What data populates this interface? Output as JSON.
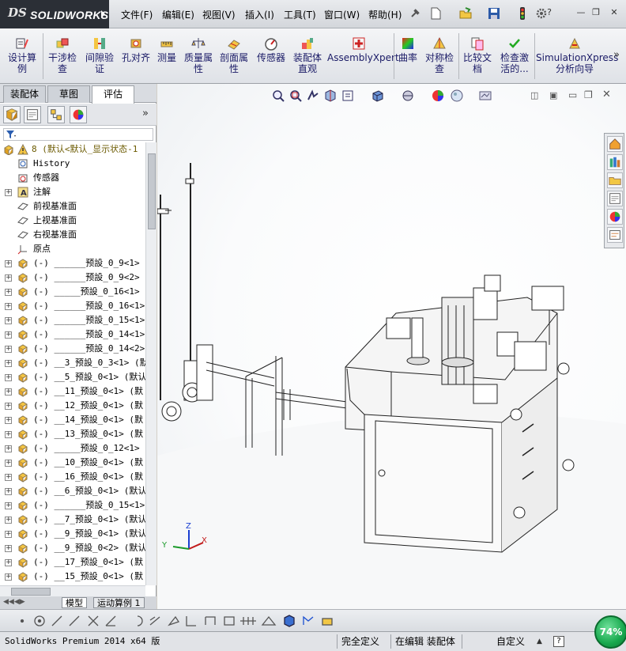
{
  "app": {
    "logo_ds": "DS",
    "logo_text": "SOLIDWORKS"
  },
  "menu": [
    "文件(F)",
    "编辑(E)",
    "视图(V)",
    "插入(I)",
    "工具(T)",
    "窗口(W)",
    "帮助(H)"
  ],
  "window_controls": {
    "help": "?",
    "minimize": "—",
    "restore": "❐",
    "close": "✕"
  },
  "commands": [
    {
      "label": "设计算\n例",
      "icon": "design-study-icon"
    },
    {
      "label": "干涉检\n查",
      "icon": "interference-check-icon"
    },
    {
      "label": "间隙验\n证",
      "icon": "clearance-verification-icon"
    },
    {
      "label": "孔对齐",
      "icon": "hole-alignment-icon"
    },
    {
      "label": "测量",
      "icon": "measure-icon"
    },
    {
      "label": "质量属\n性",
      "icon": "mass-properties-icon"
    },
    {
      "label": "剖面属\n性",
      "icon": "section-properties-icon"
    },
    {
      "label": "传感器",
      "icon": "sensor-icon"
    },
    {
      "label": "装配体\n直观",
      "icon": "assembly-visualization-icon"
    },
    {
      "label": "AssemblyXpert",
      "icon": "assemblyxpert-icon"
    },
    {
      "label": "曲率",
      "icon": "curvature-icon"
    },
    {
      "label": "对称检\n查",
      "icon": "symmetry-check-icon"
    },
    {
      "label": "比较文\n档",
      "icon": "compare-documents-icon"
    },
    {
      "label": "检查激\n活的...",
      "icon": "check-active-icon"
    },
    {
      "label": "SimulationXpress\n分析向导",
      "icon": "simulationxpress-icon"
    }
  ],
  "more_commands": "»",
  "panel_tabs": [
    "装配体",
    "草图",
    "评估"
  ],
  "panel_active_tab": "评估",
  "panel_expand": "»",
  "tree": {
    "root": "8  (默认<默认_显示状态-1",
    "items": [
      {
        "label": "History",
        "icon": "history-icon",
        "expand": false
      },
      {
        "label": "传感器",
        "icon": "sensor-folder-icon",
        "expand": false
      },
      {
        "label": "注解",
        "icon": "annotations-icon",
        "expand": true
      },
      {
        "label": "前视基准面",
        "icon": "plane-icon",
        "expand": false
      },
      {
        "label": "上视基准面",
        "icon": "plane-icon",
        "expand": false
      },
      {
        "label": "右视基准面",
        "icon": "plane-icon",
        "expand": false
      },
      {
        "label": "原点",
        "icon": "origin-icon",
        "expand": false
      },
      {
        "label": "(-) ______预設_0_9<1>",
        "icon": "part-icon",
        "expand": true
      },
      {
        "label": "(-) ______预設_0_9<2>",
        "icon": "part-icon",
        "expand": true
      },
      {
        "label": "(-) _____预設_0_16<1> (",
        "icon": "part-icon",
        "expand": true
      },
      {
        "label": "(-) ______预設_0_16<1>",
        "icon": "part-icon",
        "expand": true
      },
      {
        "label": "(-) ______预設_0_15<1>",
        "icon": "part-icon",
        "expand": true
      },
      {
        "label": "(-) ______预設_0_14<1>",
        "icon": "part-icon",
        "expand": true
      },
      {
        "label": "(-) ______预設_0_14<2>",
        "icon": "part-icon",
        "expand": true
      },
      {
        "label": "(-) __3_预設_0_3<1> (默",
        "icon": "part-icon",
        "expand": true
      },
      {
        "label": "(-) __5_预設_0<1> (默认",
        "icon": "part-icon",
        "expand": true
      },
      {
        "label": "(-) __11_预設_0<1> (默",
        "icon": "part-icon",
        "expand": true
      },
      {
        "label": "(-) __12_预設_0<1> (默",
        "icon": "part-icon",
        "expand": true
      },
      {
        "label": "(-) __14_预設_0<1> (默",
        "icon": "part-icon",
        "expand": true
      },
      {
        "label": "(-) __13_预設_0<1> (默",
        "icon": "part-icon",
        "expand": true
      },
      {
        "label": "(-) _____预設_0_12<1> (",
        "icon": "part-icon",
        "expand": true
      },
      {
        "label": "(-) __10_预設_0<1> (默",
        "icon": "part-icon",
        "expand": true
      },
      {
        "label": "(-) __16_预設_0<1> (默",
        "icon": "part-icon",
        "expand": true
      },
      {
        "label": "(-) __6_预設_0<1> (默认",
        "icon": "part-icon",
        "expand": true
      },
      {
        "label": "(-) ______预設_0_15<1> (",
        "icon": "part-icon",
        "expand": true
      },
      {
        "label": "(-) __7_预設_0<1> (默认",
        "icon": "part-icon",
        "expand": true
      },
      {
        "label": "(-) __9_预設_0<1> (默认",
        "icon": "part-icon",
        "expand": true
      },
      {
        "label": "(-) __9_预設_0<2> (默认",
        "icon": "part-icon",
        "expand": true
      },
      {
        "label": "(-) __17_预設_0<1> (默",
        "icon": "part-icon",
        "expand": true
      },
      {
        "label": "(-) __15_预設_0<1> (默",
        "icon": "part-icon",
        "expand": true
      }
    ]
  },
  "bottom_tabs": [
    "模型",
    "运动算例 1"
  ],
  "triad": {
    "x": "X",
    "y": "Y",
    "z": "Z"
  },
  "status": {
    "product": "SolidWorks Premium 2014 x64 版",
    "constraint": "完全定义",
    "mode": "在编辑 装配体",
    "units": "自定义",
    "help": "?"
  },
  "zoom_badge": "74%",
  "colors": {
    "accent": "#1a1a66",
    "badge": "#17a84d"
  }
}
